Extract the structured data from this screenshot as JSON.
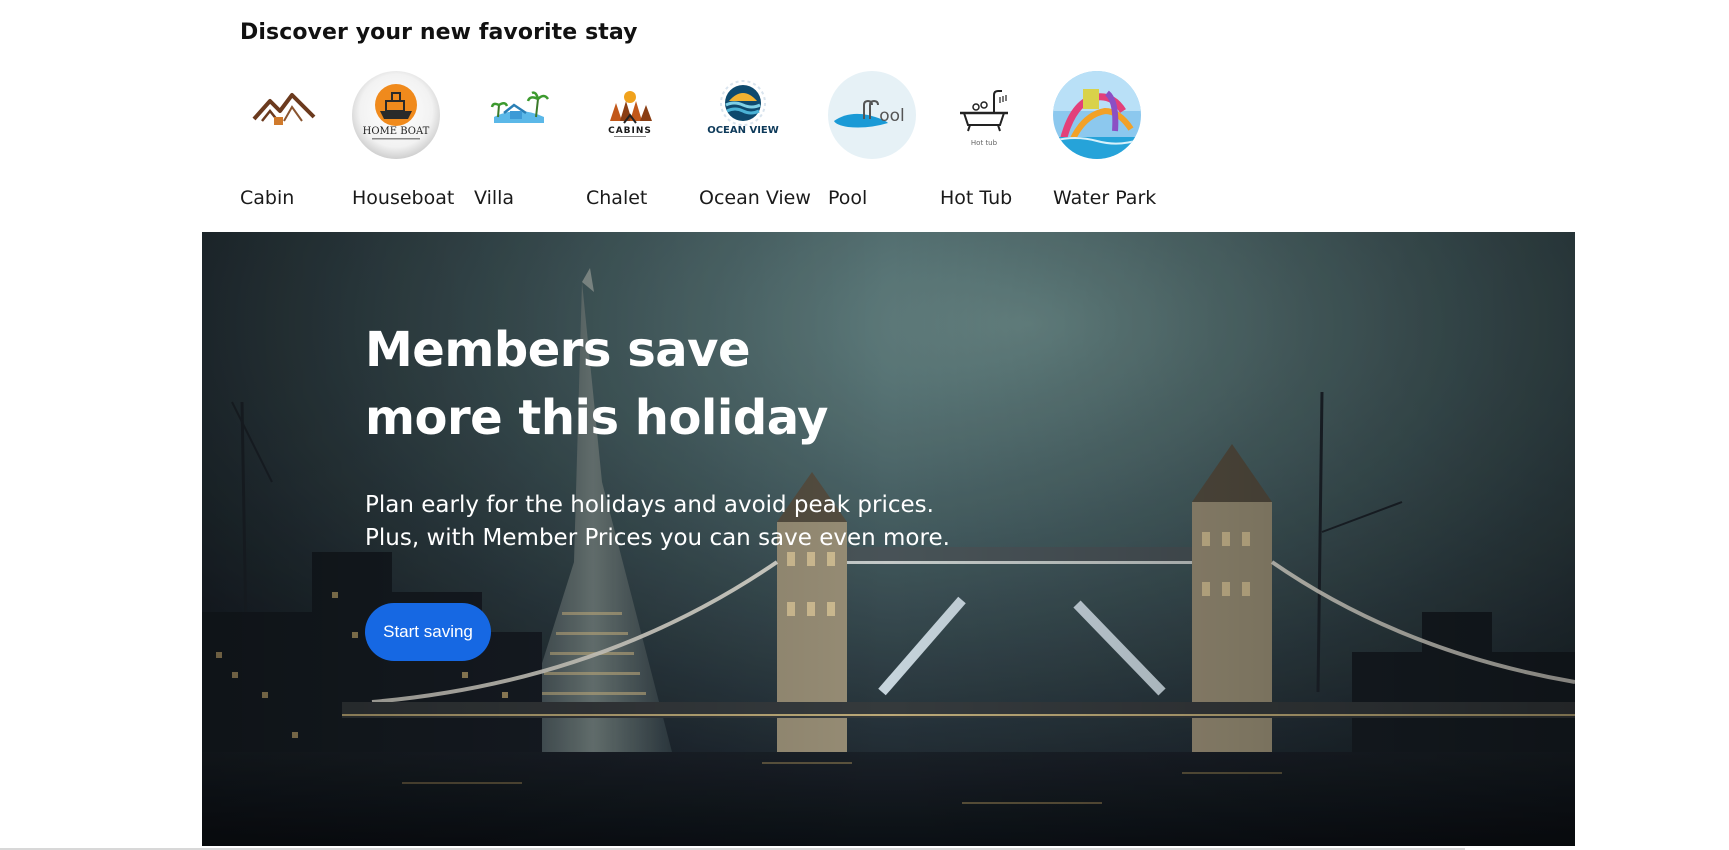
{
  "discover": {
    "title": "Discover your new favorite stay",
    "categories": [
      {
        "label": "Cabin",
        "icon": "cabin-logo-icon"
      },
      {
        "label": "Houseboat",
        "icon": "houseboat-logo-icon",
        "logo_text": "HOME BOAT"
      },
      {
        "label": "Villa",
        "icon": "villa-logo-icon"
      },
      {
        "label": "Chalet",
        "icon": "chalet-logo-icon",
        "logo_text": "CABINS"
      },
      {
        "label": "Ocean View",
        "icon": "ocean-view-logo-icon",
        "logo_text": "OCEAN VIEW"
      },
      {
        "label": "Pool",
        "icon": "pool-logo-icon",
        "logo_text": "Pool"
      },
      {
        "label": "Hot Tub",
        "icon": "hot-tub-logo-icon",
        "logo_text": "Hot tub"
      },
      {
        "label": "Water Park",
        "icon": "water-park-photo-icon"
      }
    ]
  },
  "hero": {
    "heading_line1": "Members save",
    "heading_line2": "more this holiday",
    "subtext_line1": "Plan early for the holidays and avoid peak prices.",
    "subtext_line2": "Plus, with Member Prices you can save even more.",
    "button_label": "Start saving",
    "background": "london-tower-bridge-night-photo"
  },
  "colors": {
    "accent": "#1668e3",
    "text": "#1a1a1a",
    "hero_text": "#ffffff"
  }
}
